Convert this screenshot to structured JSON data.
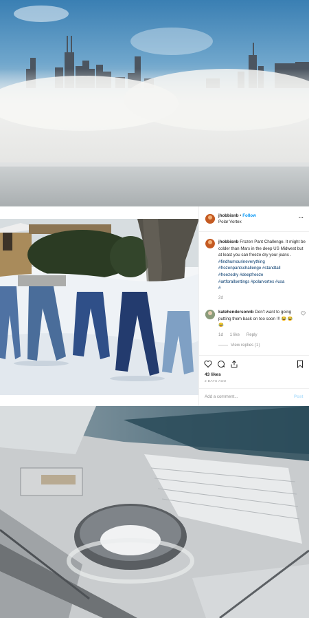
{
  "post": {
    "username": "jhobbisnb",
    "separator": "•",
    "follow_label": "Follow",
    "location": "Polar Vortex",
    "more_label": "...",
    "caption": {
      "username": "jhobbisnb",
      "text": "Frozen Pant Challenge. It might be colder than Mars in the deep US Midwest but at least you can freeze dry your jeans .",
      "hashtags": [
        "#findhumourineverything",
        "#frozenpantschallenge #standtall",
        "#freezedry #deepfreeze",
        "#artforallsettings #polarvortex #usa",
        "#"
      ],
      "time": "2d"
    },
    "comment": {
      "username": "katehendersonnb",
      "text": "Don't want to going putting them back on too soon !!! 😂 😂 😂",
      "time": "1d",
      "likes": "1 like",
      "reply_label": "Reply",
      "view_replies": "View replies (1)"
    },
    "likes": "43 likes",
    "date": "2 DAYS AGO",
    "add_comment_placeholder": "Add a comment...",
    "post_button": "Post"
  },
  "colors": {
    "link_blue": "#0095f6",
    "text": "#262626",
    "muted": "#8e8e8e"
  },
  "icons": [
    "heart-icon",
    "comment-icon",
    "share-icon",
    "bookmark-icon",
    "small-heart-icon",
    "more-icon"
  ]
}
